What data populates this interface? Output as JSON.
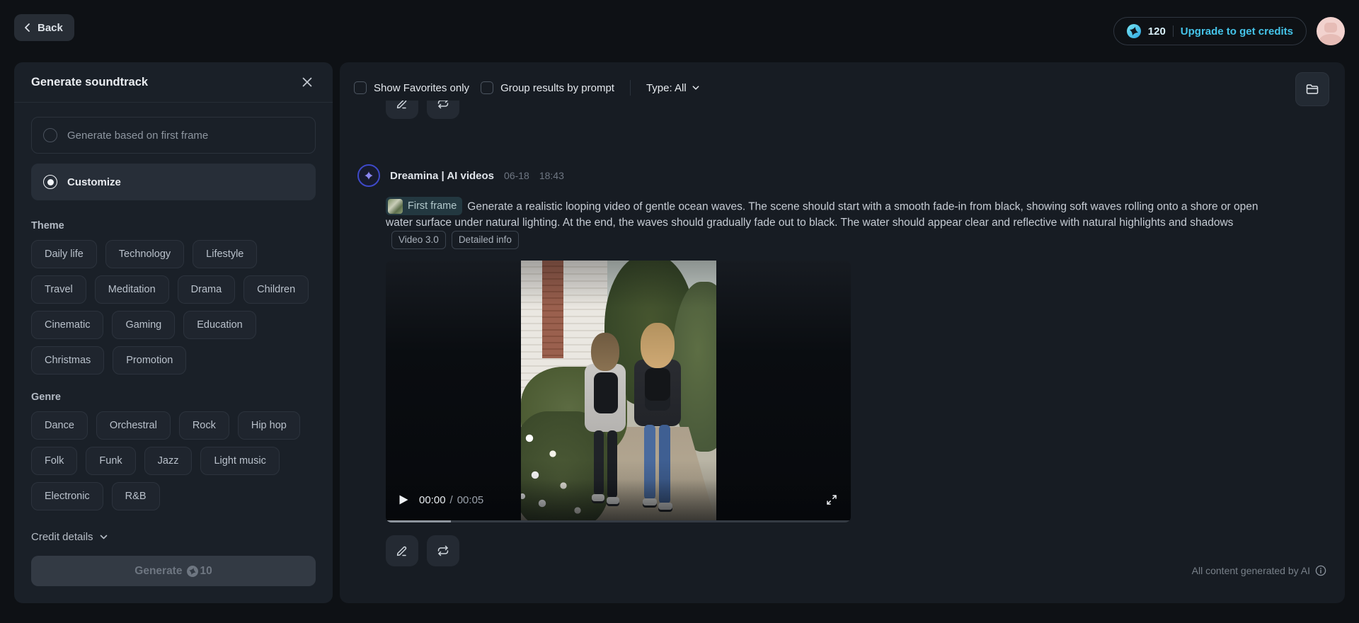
{
  "topbar": {
    "back_label": "Back",
    "credits": "120",
    "upgrade_label": "Upgrade to get credits"
  },
  "panel": {
    "title": "Generate soundtrack",
    "option_first_frame": "Generate based on first frame",
    "option_customize": "Customize",
    "theme_label": "Theme",
    "theme_chips": [
      "Daily life",
      "Technology",
      "Lifestyle",
      "Travel",
      "Meditation",
      "Drama",
      "Children",
      "Cinematic",
      "Gaming",
      "Education",
      "Christmas",
      "Promotion"
    ],
    "genre_label": "Genre",
    "genre_chips": [
      "Dance",
      "Orchestral",
      "Rock",
      "Hip hop",
      "Folk",
      "Funk",
      "Jazz",
      "Light music",
      "Electronic",
      "R&B"
    ],
    "credit_details_label": "Credit details",
    "generate_label": "Generate",
    "generate_cost": "10"
  },
  "main": {
    "filter_favorites": "Show Favorites only",
    "filter_group": "Group results by prompt",
    "filter_type": "Type: All",
    "post": {
      "author": "Dreamina | AI videos",
      "date": "06-18",
      "time": "18:43",
      "first_frame_label": "First frame",
      "prompt": "Generate a realistic looping video of gentle ocean waves. The scene should start with a smooth fade-in from black, showing soft waves rolling onto a shore or open water surface under natural lighting. At the end, the waves should gradually fade out to black. The water should appear clear and reflective with natural highlights and shadows",
      "model_tag": "Video 3.0",
      "info_tag": "Detailed info",
      "video": {
        "current_time": "00:00",
        "separator": "/",
        "duration": "00:05"
      }
    },
    "footer_note": "All content generated by AI"
  },
  "colors": {
    "accent_cyan": "#45c4e9",
    "avatar_pink": "#f2d2ce",
    "brand_purple": "#8b87f0",
    "panel_bg": "#1a2028",
    "main_bg": "#171c23"
  }
}
